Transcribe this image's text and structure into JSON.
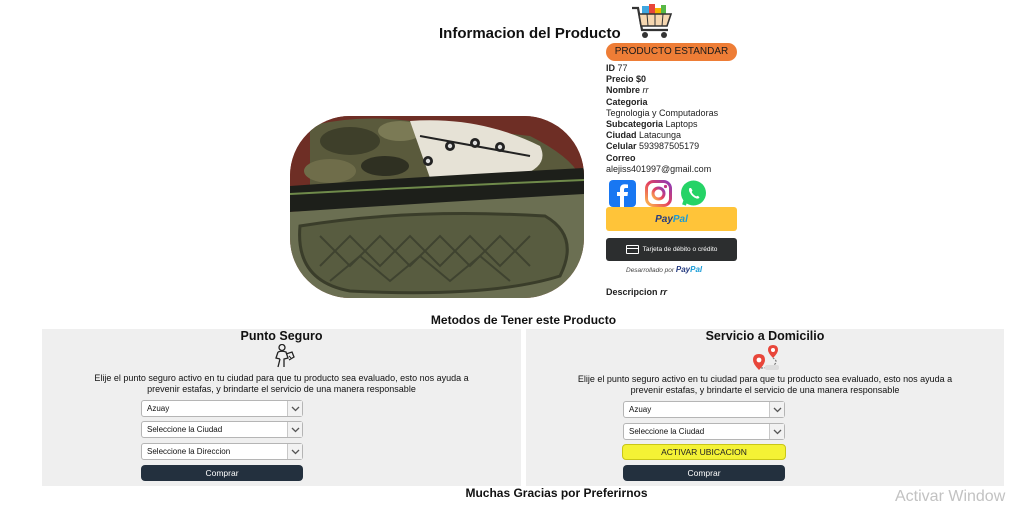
{
  "page": {
    "title": "Informacion del Producto"
  },
  "product": {
    "badge": "PRODUCTO ESTANDAR",
    "id_label": "ID",
    "id_value": "77",
    "price_label": "Precio",
    "price_value": "$0",
    "name_label": "Nombre",
    "name_value": "rr",
    "category_label": "Categoria",
    "category_value": "Tegnologia y Computadoras",
    "subcategory_label": "Subcategoria",
    "subcategory_value": "Laptops",
    "city_label": "Ciudad",
    "city_value": "Latacunga",
    "phone_label": "Celular",
    "phone_value": "593987505179",
    "email_label": "Correo",
    "email_value": "alejiss401997@gmail.com",
    "description_label": "Descripcion",
    "description_value": "rr"
  },
  "social": {
    "icons": [
      "facebook-icon",
      "instagram-icon",
      "whatsapp-icon"
    ],
    "colors": {
      "facebook": "#1877f2",
      "instagram": "#e4405f",
      "whatsapp": "#25d366"
    }
  },
  "payment": {
    "paypal_part1": "Pay",
    "paypal_part2": "Pal",
    "card_label": "Tarjeta de débito o crédito",
    "powered_text": "Desarrollado por",
    "powered_brand_1": "Pay",
    "powered_brand_2": "Pal"
  },
  "methods": {
    "title": "Metodos de Tener este Producto",
    "description": "Elije el punto seguro activo en tu ciudad para que tu producto sea evaluado, esto nos ayuda a prevenir estafas, y brindarte el servicio de una manera responsable",
    "safe_point": {
      "title": "Punto Seguro",
      "icon": "handshake-person-icon",
      "province": "Azuay",
      "city": "Seleccione la Ciudad",
      "address": "Seleccione la Direccion",
      "button": "Comprar"
    },
    "delivery": {
      "title": "Servicio a Domicilio",
      "icon": "map-route-pin-icon",
      "province": "Azuay",
      "city": "Seleccione la Ciudad",
      "location_button": "ACTIVAR UBICACION",
      "button": "Comprar"
    }
  },
  "footer": {
    "thanks": "Muchas Gracias por Preferirnos",
    "watermark": "Activar Window"
  },
  "colors": {
    "badge": "#ee7d36",
    "paypal": "#ffc439",
    "dark_button": "#23303e",
    "yellow_button": "#f4f235",
    "panel": "#efefef"
  }
}
